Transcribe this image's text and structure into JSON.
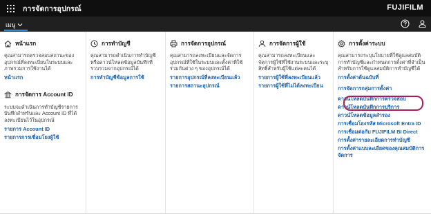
{
  "app": {
    "title": "การจัดการอุปกรณ์",
    "brand": "FUJIFILM"
  },
  "nav": {
    "menu_label": "เมนู"
  },
  "colors": {
    "topbar": "#0f0f0f",
    "navbar": "#202020",
    "accent": "#2b8fd6",
    "link": "#1a5fa8",
    "highlight": "#a51c63"
  },
  "columns": [
    {
      "icon": "home-icon",
      "title": "หน้าแรก",
      "description": "คุณสามารถตรวจสอบสถานะของอุปกรณ์ที่ลงทะเบียนในระบบและภาพรวมการใช้งานได้",
      "links": [
        "หน้าแรก"
      ],
      "section2": {
        "icon": "building-icon",
        "title": "การจัดการ Account ID",
        "description": "ระบบจะดำเนินการทำบัญชีรายการบันทึกสำหรับและ Account ID ที่ได้ลงทะเบียนไว้ในอุปกรณ์",
        "links": [
          "รายการ Account ID",
          "รายการการเชื่อมโยงผู้ใช้"
        ]
      }
    },
    {
      "icon": "clock-icon",
      "title": "การทำบัญชี",
      "description": "คุณสามารถดำเนินการทำบัญชีหรือดาวน์โหลดข้อมูลบันทึกที่รวบรวมจากอุปกรณ์ได้",
      "links": [
        "การทำบัญชีข้อมูลการใช้"
      ]
    },
    {
      "icon": "printer-icon",
      "title": "การจัดการอุปกรณ์",
      "description": "คุณสามารถลงทะเบียนและจัดการอุปกรณ์ที่ใช้ในระบบและตั้งค่าที่ใช้ร่วมกันต่าง ๆ ของอุปกรณ์ได้",
      "links": [
        "รายการอุปกรณ์ที่ลงทะเบียนแล้ว",
        "รายการสถานะอุปกรณ์"
      ]
    },
    {
      "icon": "users-icon",
      "title": "การจัดการผู้ใช้",
      "description": "คุณสามารถลงทะเบียนและจัดการผู้ใช้ที่ใช้งานระบบและระบุสิทธิ์สำหรับผู้ใช้แต่ละคนได้",
      "links": [
        "รายการผู้ใช้ที่ลงทะเบียนแล้ว",
        "รายการผู้ใช้ที่ไม่ได้ลงทะเบียน"
      ]
    },
    {
      "icon": "gear-icon",
      "title": "การตั้งค่าระบบ",
      "description": "คุณสามารถระบุนโยบายที่ใช้ดูแลสมบัติการทำบัญชีและกำหนดการตั้งค่าที่จำเป็นสำหรับการใช้ดูแลสมบัติการทำบัญชีได้",
      "links": [
        "การตั้งค่าต้นฉบับที่",
        "การจัดการกลุ่มการตั้งค่า",
        "ดาวน์โหลดบันทึกการตรวจสอบ",
        "ดาวน์โหลดบันทึกการบริการ",
        "ดาวน์โหลดข้อมูลสำรอง",
        "การเชื่อมโยงรหัส Microsoft Entra ID",
        "การเชื่อมต่อกับ FUJIFILM BI Direct",
        "การตั้งค่ารายละเอียดการทำบัญชี",
        "การตั้งค่าแบบละเอียดของคุณสมบัติการจัดการ"
      ]
    }
  ]
}
